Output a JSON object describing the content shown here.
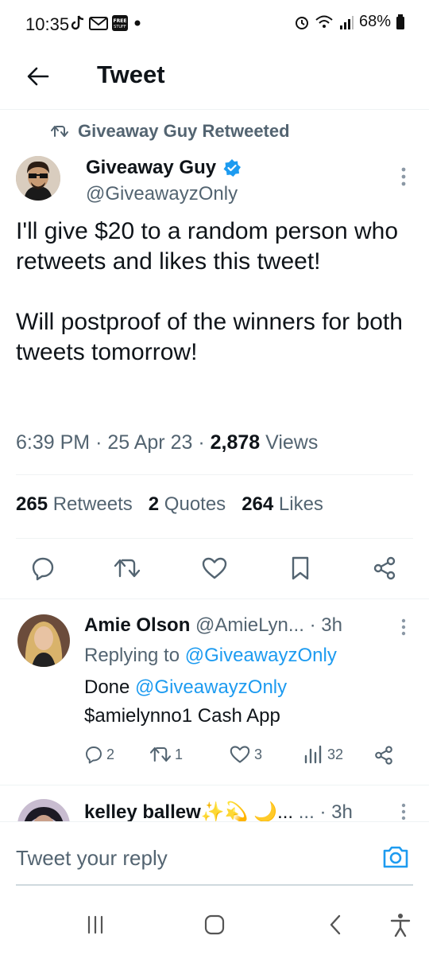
{
  "status_bar": {
    "time": "10:35",
    "battery": "68%",
    "icons": [
      "tiktok-icon",
      "gmail-icon",
      "free-stuff-icon",
      "dot-icon",
      "alarm-icon",
      "wifi-icon",
      "signal-icon",
      "battery-icon"
    ]
  },
  "header": {
    "title": "Tweet",
    "back_icon": "arrow-left-icon"
  },
  "tweet": {
    "retweeted_by": "Giveaway Guy Retweeted",
    "author_name": "Giveaway Guy",
    "verified": true,
    "author_handle": "@GiveawayzOnly",
    "text": "I'll give $20 to a random person who retweets and likes this tweet!\n\nWill postproof of the winners for both tweets tomorrow!",
    "time": "6:39 PM",
    "date": "25 Apr 23",
    "views_count": "2,878",
    "views_label": "Views",
    "retweets_count": "265",
    "retweets_label": "Retweets",
    "quotes_count": "2",
    "quotes_label": "Quotes",
    "likes_count": "264",
    "likes_label": "Likes"
  },
  "replies": [
    {
      "name": "Amie Olson",
      "handle": "@AmieLyn...",
      "age": "· 3h",
      "replying_label": "Replying to",
      "replying_to": "@GiveawayzOnly",
      "text_line1_prefix": "Done",
      "text_line1_mention": "@GiveawayzOnly",
      "text_line2": "$amielynno1 Cash App",
      "reply_count": "2",
      "retweet_count": "1",
      "like_count": "3",
      "view_count": "32"
    },
    {
      "name": "kelley ballew",
      "name_emojis": "✨💫 🌙...",
      "handle": "...",
      "age": "· 3h"
    }
  ],
  "reply_bar": {
    "placeholder": "Tweet your reply"
  },
  "colors": {
    "accent": "#1d9bf0",
    "secondary_text": "#536471",
    "primary_text": "#0f1419",
    "divider": "#eff3f4"
  }
}
